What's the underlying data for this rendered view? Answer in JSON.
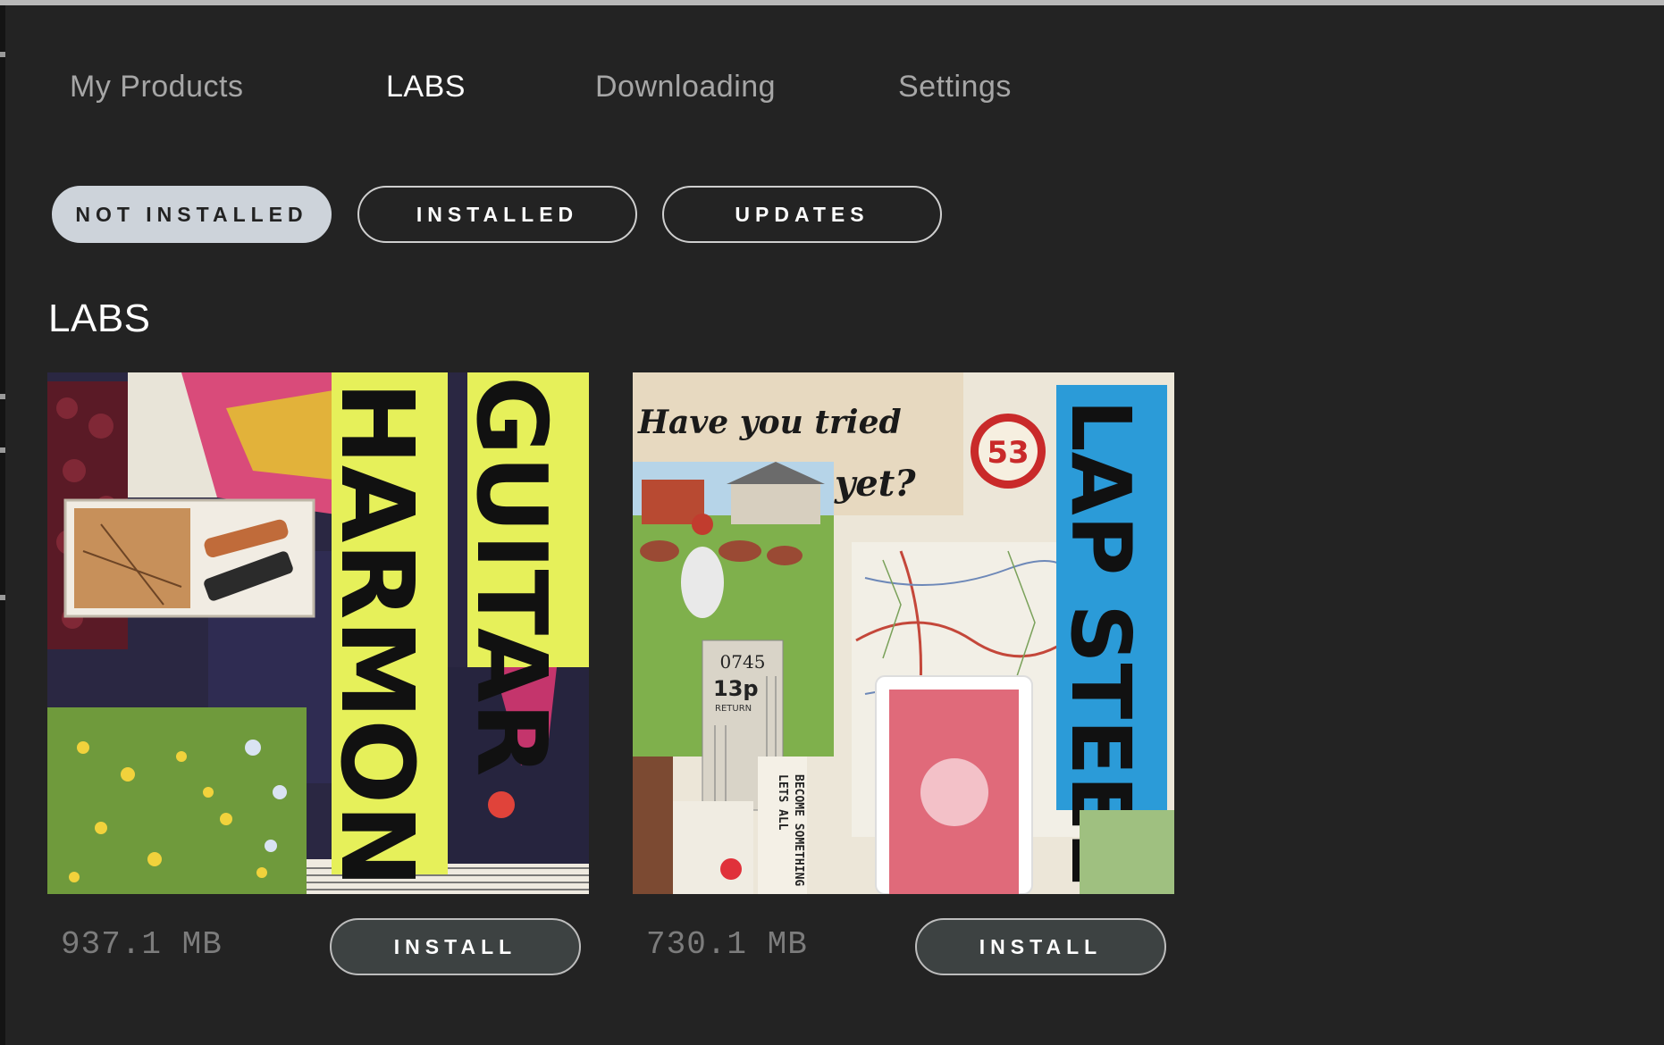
{
  "nav": {
    "tabs": [
      {
        "label": "My Products",
        "active": false
      },
      {
        "label": "LABS",
        "active": true
      },
      {
        "label": "Downloading",
        "active": false
      },
      {
        "label": "Settings",
        "active": false
      }
    ]
  },
  "filters": [
    {
      "label": "NOT INSTALLED",
      "active": true
    },
    {
      "label": "INSTALLED",
      "active": false
    },
    {
      "label": "UPDATES",
      "active": false
    }
  ],
  "section": {
    "title": "LABS"
  },
  "products": [
    {
      "art_text": [
        "GUITAR",
        "HARMONICS"
      ],
      "size": "937.1 MB",
      "install_label": "INSTALL"
    },
    {
      "art_text": {
        "tagline_1": "Have you tried",
        "tagline_2": "yet?",
        "badge": "53",
        "name": "LAP STEEL",
        "ticket_code": "0745",
        "ticket_price": "13p",
        "ticket_type": "RETURN",
        "caption_1": "LETS ALL",
        "caption_2": "BECOME SOMETHING"
      },
      "size": "730.1 MB",
      "install_label": "INSTALL"
    }
  ],
  "colors": {
    "background": "#232323",
    "active_pill": "#cdd3da",
    "install_button": "#3d4242",
    "lap_steel_blue": "#2b9bd8",
    "harmonics_yellow": "#e6f05a"
  }
}
